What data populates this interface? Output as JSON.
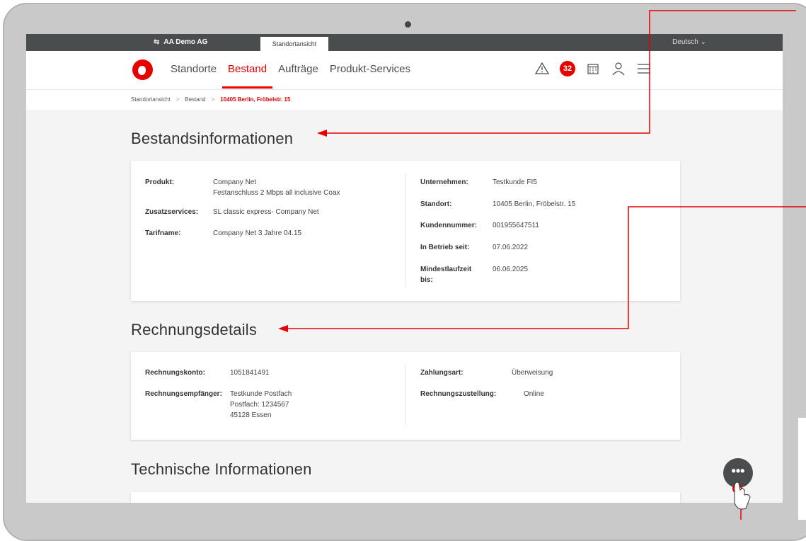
{
  "topbar": {
    "company": "AA Demo AG",
    "active_tab": "Standortansicht",
    "language": "Deutsch"
  },
  "nav": {
    "items": [
      "Standorte",
      "Bestand",
      "Aufträge",
      "Produkt-Services"
    ],
    "active": "Bestand",
    "badge_count": "32"
  },
  "breadcrumb": {
    "items": [
      "Standortansicht",
      "Bestand"
    ],
    "current": "10405 Berlin, Fröbelstr. 15"
  },
  "sections": {
    "bestand": {
      "title": "Bestandsinformationen",
      "produkt_label": "Produkt:",
      "produkt_value_1": "Company Net",
      "produkt_value_2": "Festanschluss 2 Mbps all inclusive Coax",
      "zusatz_label": "Zusatzservices:",
      "zusatz_value": "SL classic express- Company Net",
      "tarif_label": "Tarifname:",
      "tarif_value": "Company Net 3 Jahre 04.15",
      "unternehmen_label": "Unternehmen:",
      "unternehmen_value": "Testkunde FI5",
      "standort_label": "Standort:",
      "standort_value": "10405 Berlin, Fröbelstr. 15",
      "kunden_label": "Kundennummer:",
      "kunden_value": "001955647511",
      "betrieb_label": "In Betrieb seit:",
      "betrieb_value": "07.06.2022",
      "mindest_label_1": "Mindestlaufzeit",
      "mindest_label_2": "bis:",
      "mindest_value": "06.06.2025"
    },
    "rechnung": {
      "title": "Rechnungsdetails",
      "konto_label": "Rechnungskonto:",
      "konto_value": "1051841491",
      "empf_label": "Rechnungsempfänger:",
      "empf_value_1": "Testkunde Postfach",
      "empf_value_2": "Postfach: 1234567",
      "empf_value_3": "45128 Essen",
      "zahl_label": "Zahlungsart:",
      "zahl_value": "Überweisung",
      "zustell_label": "Rechnungszustellung:",
      "zustell_value": "Online"
    },
    "technik": {
      "title": "Technische Informationen"
    }
  },
  "fab": {
    "label": "•••"
  },
  "colors": {
    "brand": "#e60000",
    "dark": "#4a4d4e"
  }
}
